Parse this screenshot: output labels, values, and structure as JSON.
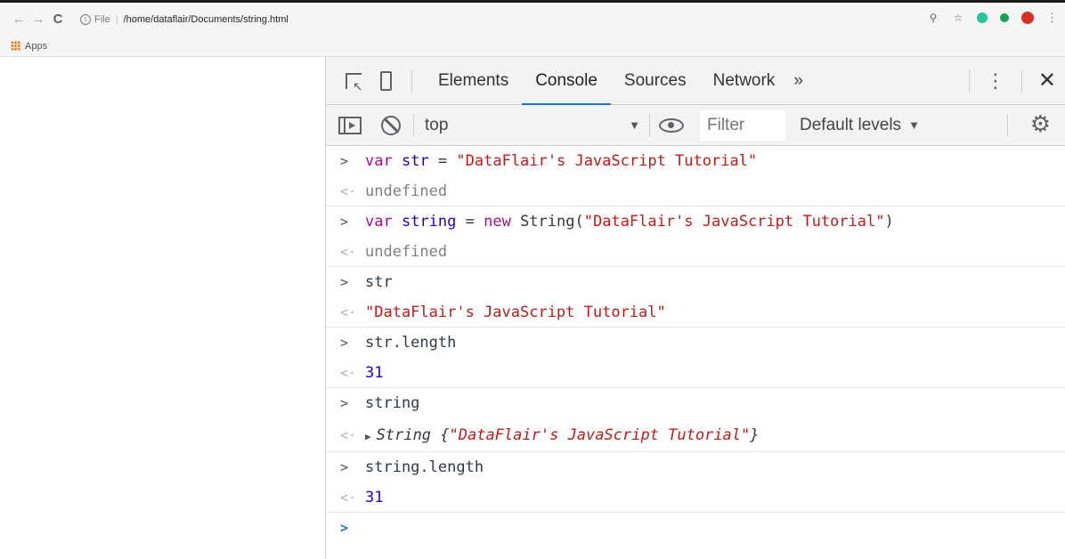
{
  "browser": {
    "back_glyph": "←",
    "forward_glyph": "→",
    "reload_glyph": "C",
    "scheme": "File",
    "separator": "|",
    "url": "/home/dataflair/Documents/string.html",
    "bookmarks": {
      "apps_label": "Apps"
    }
  },
  "devtools": {
    "tabs": [
      {
        "label": "Elements"
      },
      {
        "label": "Console"
      },
      {
        "label": "Sources"
      },
      {
        "label": "Network"
      }
    ],
    "more_tabs_glyph": "»",
    "menu_glyph": "⋮",
    "close_glyph": "✕",
    "console_toolbar": {
      "context": "top",
      "filter_placeholder": "Filter",
      "levels": "Default levels",
      "caret": "▼"
    },
    "accent_color": "#1a73e8"
  },
  "console": {
    "input_prompt": ">",
    "output_prompt": "<·",
    "entries": {
      "e1_kw": "var",
      "e1_var": "str",
      "e1_op": " = ",
      "e1_str": "\"DataFlair's JavaScript Tutorial\"",
      "e1_out": "undefined",
      "e2_kw": "var",
      "e2_var": "string",
      "e2_op": " = ",
      "e2_new": "new",
      "e2_call": " String(",
      "e2_str": "\"DataFlair's JavaScript Tutorial\"",
      "e2_close": ")",
      "e2_out": "undefined",
      "e3_in": "str",
      "e3_out": "\"DataFlair's JavaScript Tutorial\"",
      "e4_in": "str.length",
      "e4_out": "31",
      "e5_in": "string",
      "e5_out_prefix": "String {",
      "e5_out_str": "\"DataFlair's JavaScript Tutorial\"",
      "e5_out_suffix": "}",
      "e6_in": "string.length",
      "e6_out": "31"
    }
  }
}
